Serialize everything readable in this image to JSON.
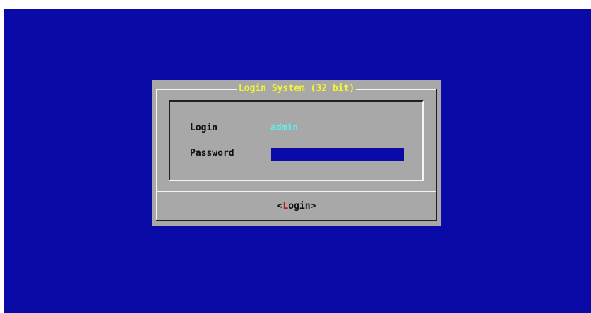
{
  "dialog": {
    "title": "Login System (32 bit)"
  },
  "form": {
    "login_label": "Login",
    "login_value": "admin",
    "password_label": "Password",
    "password_value": ""
  },
  "button": {
    "open_bracket": "<",
    "hotkey": "L",
    "rest": "ogin",
    "close_bracket": ">"
  },
  "colors": {
    "screen_background": "#0a0aa6",
    "dialog_background": "#a8a8a8",
    "title_text": "#f5f532",
    "login_value_text": "#5ef0f0",
    "hotkey_text": "#c21818",
    "password_field": "#0a0aa6"
  }
}
